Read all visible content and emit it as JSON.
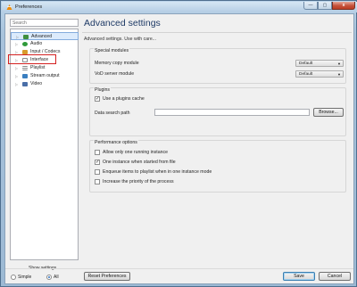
{
  "window": {
    "title": "Preferences",
    "controls": {
      "minimize": "—",
      "maximize": "▢",
      "close": "x"
    }
  },
  "sidebar": {
    "search_placeholder": "Search",
    "items": [
      {
        "label": "Advanced",
        "icon": "advanced-icon",
        "color": "#3f8f3f",
        "selected": true
      },
      {
        "label": "Audio",
        "icon": "audio-icon",
        "color": "#2f9a3a"
      },
      {
        "label": "Input / Codecs",
        "icon": "codecs-icon",
        "color": "#d99a2b"
      },
      {
        "label": "Interface",
        "icon": "interface-icon",
        "color": "#8a8a8a"
      },
      {
        "label": "Playlist",
        "icon": "playlist-icon",
        "color": "#8a8a8a"
      },
      {
        "label": "Stream output",
        "icon": "stream-output-icon",
        "color": "#3a7fc0"
      },
      {
        "label": "Video",
        "icon": "video-icon",
        "color": "#4a6fa8"
      }
    ],
    "show_settings_label": "Show settings",
    "simple_label": "Simple",
    "all_label": "All",
    "selected_mode": "All"
  },
  "main": {
    "title": "Advanced settings",
    "subtitle": "Advanced settings. Use with care...",
    "special_modules": {
      "title": "Special modules",
      "memory_copy_label": "Memory copy module",
      "memory_copy_value": "Default",
      "vod_server_label": "VoD server module",
      "vod_server_value": "Default"
    },
    "plugins": {
      "title": "Plugins",
      "use_cache_label": "Use a plugins cache",
      "use_cache_checked": true,
      "data_search_label": "Data search path",
      "data_search_value": "",
      "browse_label": "Browse..."
    },
    "performance": {
      "title": "Performance options",
      "options": [
        {
          "label": "Allow only one running instance",
          "checked": false
        },
        {
          "label": "One instance when started from file",
          "checked": true
        },
        {
          "label": "Enqueue items to playlist when in one instance mode",
          "checked": false
        },
        {
          "label": "Increase the priority of the process",
          "checked": false
        }
      ]
    }
  },
  "footer": {
    "reset_label": "Reset Preferences",
    "save_label": "Save",
    "cancel_label": "Cancel"
  },
  "colors": {
    "highlight_border": "#d42020",
    "title_text": "#1e3a66"
  }
}
